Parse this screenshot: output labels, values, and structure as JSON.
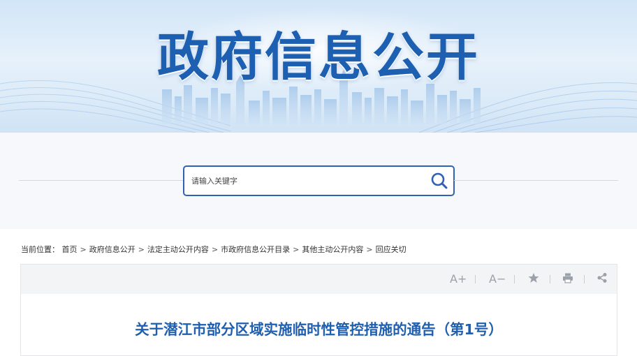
{
  "banner": {
    "title": "政府信息公开"
  },
  "search": {
    "placeholder": "请输入关键字",
    "button_icon": "search-icon"
  },
  "breadcrumb": {
    "prefix": "当前位置：",
    "items": [
      "首页",
      "政府信息公开",
      "法定主动公开内容",
      "市政府信息公开目录",
      "其他主动公开内容",
      "回应关切"
    ],
    "separator": ">"
  },
  "toolbar": {
    "font_increase_label": "A+",
    "font_decrease_label": "A−",
    "favorite_icon": "star-icon",
    "print_icon": "printer-icon",
    "share_icon": "share-icon"
  },
  "article": {
    "title": "关于潜江市部分区域实施临时性管控措施的通告（第1号）"
  },
  "colors": {
    "brand_blue": "#1d5fb1",
    "search_border": "#2f62b4",
    "title_blue": "#1f5fb0"
  }
}
